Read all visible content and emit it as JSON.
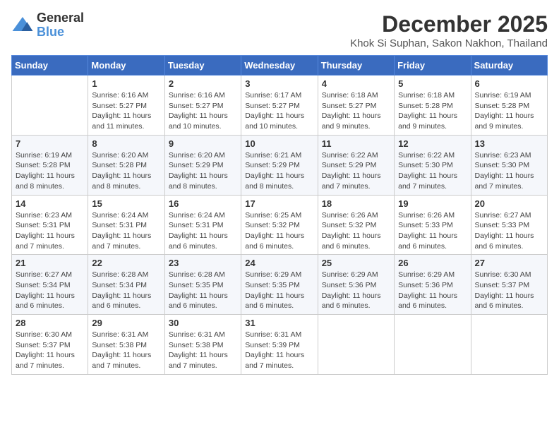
{
  "logo": {
    "general": "General",
    "blue": "Blue"
  },
  "title": "December 2025",
  "subtitle": "Khok Si Suphan, Sakon Nakhon, Thailand",
  "days_of_week": [
    "Sunday",
    "Monday",
    "Tuesday",
    "Wednesday",
    "Thursday",
    "Friday",
    "Saturday"
  ],
  "weeks": [
    [
      {
        "day": "",
        "info": ""
      },
      {
        "day": "1",
        "info": "Sunrise: 6:16 AM\nSunset: 5:27 PM\nDaylight: 11 hours\nand 11 minutes."
      },
      {
        "day": "2",
        "info": "Sunrise: 6:16 AM\nSunset: 5:27 PM\nDaylight: 11 hours\nand 10 minutes."
      },
      {
        "day": "3",
        "info": "Sunrise: 6:17 AM\nSunset: 5:27 PM\nDaylight: 11 hours\nand 10 minutes."
      },
      {
        "day": "4",
        "info": "Sunrise: 6:18 AM\nSunset: 5:27 PM\nDaylight: 11 hours\nand 9 minutes."
      },
      {
        "day": "5",
        "info": "Sunrise: 6:18 AM\nSunset: 5:28 PM\nDaylight: 11 hours\nand 9 minutes."
      },
      {
        "day": "6",
        "info": "Sunrise: 6:19 AM\nSunset: 5:28 PM\nDaylight: 11 hours\nand 9 minutes."
      }
    ],
    [
      {
        "day": "7",
        "info": "Sunrise: 6:19 AM\nSunset: 5:28 PM\nDaylight: 11 hours\nand 8 minutes."
      },
      {
        "day": "8",
        "info": "Sunrise: 6:20 AM\nSunset: 5:28 PM\nDaylight: 11 hours\nand 8 minutes."
      },
      {
        "day": "9",
        "info": "Sunrise: 6:20 AM\nSunset: 5:29 PM\nDaylight: 11 hours\nand 8 minutes."
      },
      {
        "day": "10",
        "info": "Sunrise: 6:21 AM\nSunset: 5:29 PM\nDaylight: 11 hours\nand 8 minutes."
      },
      {
        "day": "11",
        "info": "Sunrise: 6:22 AM\nSunset: 5:29 PM\nDaylight: 11 hours\nand 7 minutes."
      },
      {
        "day": "12",
        "info": "Sunrise: 6:22 AM\nSunset: 5:30 PM\nDaylight: 11 hours\nand 7 minutes."
      },
      {
        "day": "13",
        "info": "Sunrise: 6:23 AM\nSunset: 5:30 PM\nDaylight: 11 hours\nand 7 minutes."
      }
    ],
    [
      {
        "day": "14",
        "info": "Sunrise: 6:23 AM\nSunset: 5:31 PM\nDaylight: 11 hours\nand 7 minutes."
      },
      {
        "day": "15",
        "info": "Sunrise: 6:24 AM\nSunset: 5:31 PM\nDaylight: 11 hours\nand 7 minutes."
      },
      {
        "day": "16",
        "info": "Sunrise: 6:24 AM\nSunset: 5:31 PM\nDaylight: 11 hours\nand 6 minutes."
      },
      {
        "day": "17",
        "info": "Sunrise: 6:25 AM\nSunset: 5:32 PM\nDaylight: 11 hours\nand 6 minutes."
      },
      {
        "day": "18",
        "info": "Sunrise: 6:26 AM\nSunset: 5:32 PM\nDaylight: 11 hours\nand 6 minutes."
      },
      {
        "day": "19",
        "info": "Sunrise: 6:26 AM\nSunset: 5:33 PM\nDaylight: 11 hours\nand 6 minutes."
      },
      {
        "day": "20",
        "info": "Sunrise: 6:27 AM\nSunset: 5:33 PM\nDaylight: 11 hours\nand 6 minutes."
      }
    ],
    [
      {
        "day": "21",
        "info": "Sunrise: 6:27 AM\nSunset: 5:34 PM\nDaylight: 11 hours\nand 6 minutes."
      },
      {
        "day": "22",
        "info": "Sunrise: 6:28 AM\nSunset: 5:34 PM\nDaylight: 11 hours\nand 6 minutes."
      },
      {
        "day": "23",
        "info": "Sunrise: 6:28 AM\nSunset: 5:35 PM\nDaylight: 11 hours\nand 6 minutes."
      },
      {
        "day": "24",
        "info": "Sunrise: 6:29 AM\nSunset: 5:35 PM\nDaylight: 11 hours\nand 6 minutes."
      },
      {
        "day": "25",
        "info": "Sunrise: 6:29 AM\nSunset: 5:36 PM\nDaylight: 11 hours\nand 6 minutes."
      },
      {
        "day": "26",
        "info": "Sunrise: 6:29 AM\nSunset: 5:36 PM\nDaylight: 11 hours\nand 6 minutes."
      },
      {
        "day": "27",
        "info": "Sunrise: 6:30 AM\nSunset: 5:37 PM\nDaylight: 11 hours\nand 6 minutes."
      }
    ],
    [
      {
        "day": "28",
        "info": "Sunrise: 6:30 AM\nSunset: 5:37 PM\nDaylight: 11 hours\nand 7 minutes."
      },
      {
        "day": "29",
        "info": "Sunrise: 6:31 AM\nSunset: 5:38 PM\nDaylight: 11 hours\nand 7 minutes."
      },
      {
        "day": "30",
        "info": "Sunrise: 6:31 AM\nSunset: 5:38 PM\nDaylight: 11 hours\nand 7 minutes."
      },
      {
        "day": "31",
        "info": "Sunrise: 6:31 AM\nSunset: 5:39 PM\nDaylight: 11 hours\nand 7 minutes."
      },
      {
        "day": "",
        "info": ""
      },
      {
        "day": "",
        "info": ""
      },
      {
        "day": "",
        "info": ""
      }
    ]
  ]
}
